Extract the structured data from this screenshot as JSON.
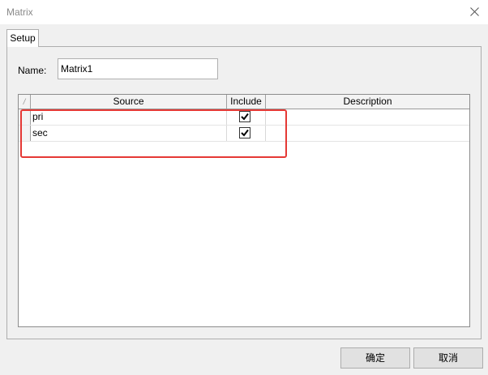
{
  "window": {
    "title": "Matrix"
  },
  "tabs": [
    {
      "label": "Setup",
      "selected": true
    }
  ],
  "form": {
    "name_label": "Name:",
    "name_value": "Matrix1"
  },
  "grid": {
    "columns": {
      "rowhead": "/",
      "source": "Source",
      "include": "Include",
      "description": "Description"
    },
    "rows": [
      {
        "source": "pri",
        "include": true,
        "description": ""
      },
      {
        "source": "sec",
        "include": true,
        "description": ""
      }
    ]
  },
  "buttons": {
    "ok": "确定",
    "cancel": "取消"
  },
  "colors": {
    "highlight": "#e53935"
  }
}
